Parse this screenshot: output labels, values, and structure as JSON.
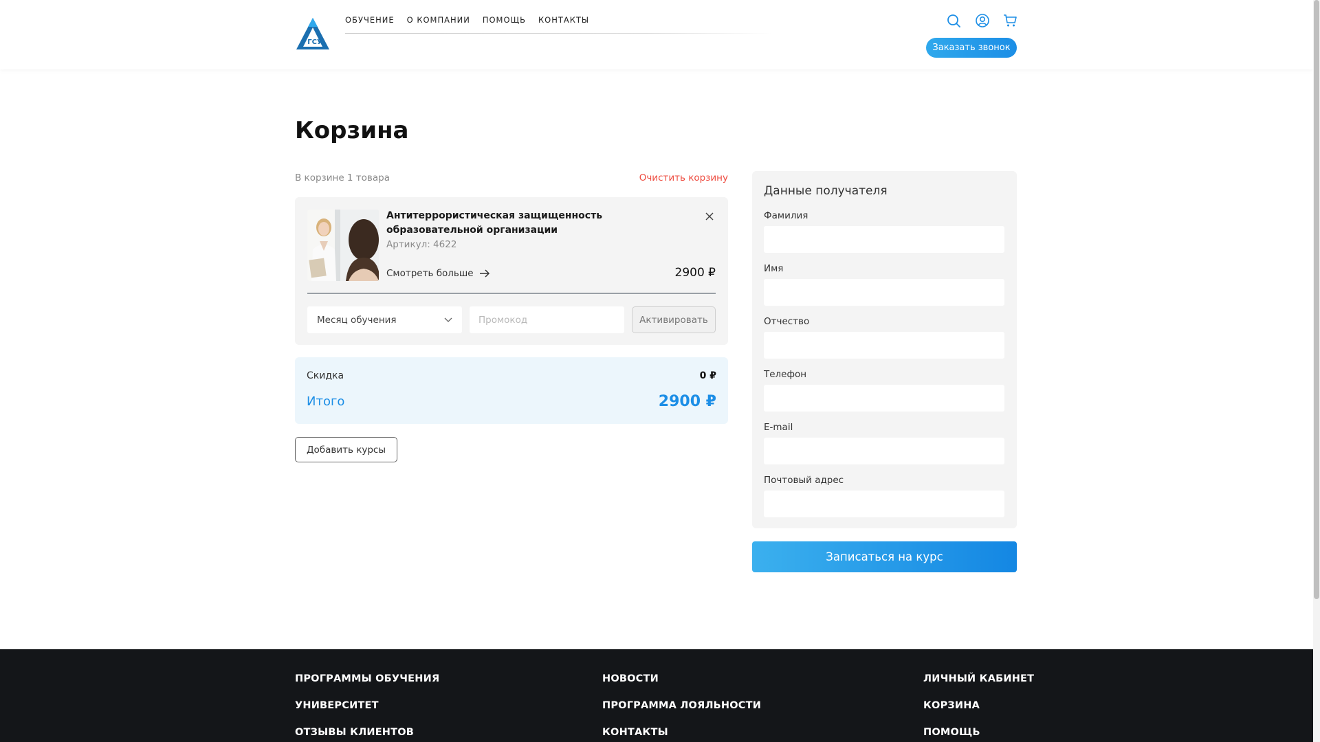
{
  "header": {
    "logo_text": "ГСУ",
    "nav": [
      "ОБУЧЕНИЕ",
      "О КОМПАНИИ",
      "ПОМОЩЬ",
      "КОНТАКТЫ"
    ],
    "icons": [
      "search-icon",
      "user-icon",
      "cart-icon"
    ],
    "callback_label": "Заказать звонок"
  },
  "page": {
    "title": "Корзина",
    "cart_count": "В корзине 1 товара",
    "clear_label": "Очистить корзину"
  },
  "cart_item": {
    "title": "Антитеррористическая защищенность образовательной организации",
    "article": "Артикул: 4622",
    "more_label": "Смотреть больше",
    "price": "2900 ₽",
    "month_placeholder": "Месяц обучения",
    "promo_placeholder": "Промокод",
    "activate_label": "Активировать"
  },
  "totals": {
    "discount_label": "Скидка",
    "discount_value": "0 ₽",
    "total_label": "Итого",
    "total_value": "2900 ₽"
  },
  "add_courses_label": "Добавить курсы",
  "form": {
    "title": "Данные получателя",
    "fields": [
      {
        "label": "Фамилия",
        "value": ""
      },
      {
        "label": "Имя",
        "value": ""
      },
      {
        "label": "Отчество",
        "value": ""
      },
      {
        "label": "Телефон",
        "value": ""
      },
      {
        "label": "E-mail",
        "value": ""
      },
      {
        "label": "Почтовый адрес",
        "value": ""
      }
    ],
    "submit_label": "Записаться на курс"
  },
  "footer": {
    "col1": [
      "ПРОГРАММЫ ОБУЧЕНИЯ",
      "УНИВЕРСИТЕТ",
      "ОТЗЫВЫ КЛИЕНТОВ"
    ],
    "col2": [
      "НОВОСТИ",
      "ПРОГРАММА ЛОЯЛЬНОСТИ",
      "КОНТАКТЫ"
    ],
    "col3": [
      "ЛИЧНЫЙ КАБИНЕТ",
      "КОРЗИНА",
      "ПОМОЩЬ"
    ]
  },
  "colors": {
    "accent": "#1c8ee6",
    "danger": "#ee4b3f",
    "footer_bg": "#141619"
  }
}
